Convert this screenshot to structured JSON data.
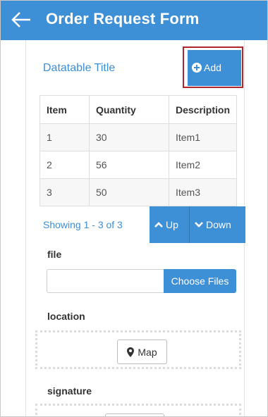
{
  "app": {
    "title": "Order Request Form"
  },
  "datatable": {
    "title": "Datatable Title",
    "add_label": "Add",
    "columns": [
      "Item",
      "Quantity",
      "Description"
    ],
    "rows": [
      [
        "1",
        "30",
        "Item1"
      ],
      [
        "2",
        "56",
        "Item2"
      ],
      [
        "3",
        "50",
        "Item3"
      ]
    ],
    "showing": "Showing 1 - 3 of 3",
    "up_label": "Up",
    "down_label": "Down"
  },
  "file": {
    "label": "file",
    "value": "",
    "choose_label": "Choose Files"
  },
  "location": {
    "label": "location",
    "map_label": "Map"
  },
  "signature": {
    "label": "signature"
  },
  "colors": {
    "primary": "#3d8fd6",
    "highlight_outline": "#b0262e"
  }
}
